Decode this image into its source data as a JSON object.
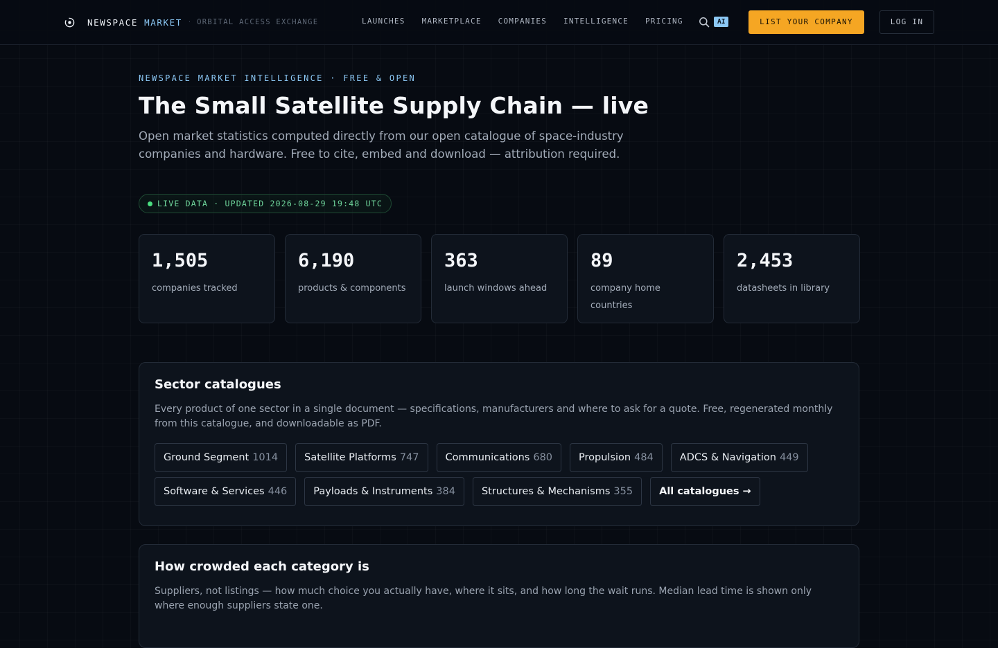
{
  "header": {
    "brand_name": "NEWSPACE",
    "brand_accent": "MARKET",
    "brand_separator": "·",
    "tagline": "ORBITAL ACCESS EXCHANGE",
    "nav": [
      "LAUNCHES",
      "MARKETPLACE",
      "COMPANIES",
      "INTELLIGENCE",
      "PRICING"
    ],
    "ai_badge": "AI",
    "cta_label": "LIST YOUR COMPANY",
    "login_label": "LOG IN"
  },
  "hero": {
    "eyebrow": "NEWSPACE MARKET INTELLIGENCE · FREE & OPEN",
    "title": "The Small Satellite Supply Chain — live",
    "lead": "Open market statistics computed directly from our open catalogue of space-industry companies and hardware. Free to cite, embed and download — attribution required.",
    "live_status": "LIVE DATA · UPDATED 2026-08-29 19:48 UTC"
  },
  "stats": [
    {
      "value": "1,505",
      "label": "companies tracked"
    },
    {
      "value": "6,190",
      "label": "products & components"
    },
    {
      "value": "363",
      "label": "launch windows ahead"
    },
    {
      "value": "89",
      "label": "company home countries"
    },
    {
      "value": "2,453",
      "label": "datasheets in library"
    }
  ],
  "sector_catalogues": {
    "title": "Sector catalogues",
    "description": "Every product of one sector in a single document — specifications, manufacturers and where to ask for a quote. Free, regenerated monthly from this catalogue, and downloadable as PDF.",
    "chips": [
      {
        "label": "Ground Segment",
        "count": "1014"
      },
      {
        "label": "Satellite Platforms",
        "count": "747"
      },
      {
        "label": "Communications",
        "count": "680"
      },
      {
        "label": "Propulsion",
        "count": "484"
      },
      {
        "label": "ADCS & Navigation",
        "count": "449"
      },
      {
        "label": "Software & Services",
        "count": "446"
      },
      {
        "label": "Payloads & Instruments",
        "count": "384"
      },
      {
        "label": "Structures & Mechanisms",
        "count": "355"
      }
    ],
    "all_label": "All catalogues →"
  },
  "crowding": {
    "title": "How crowded each category is",
    "description": "Suppliers, not listings — how much choice you actually have, where it sits, and how long the wait runs. Median lead time is shown only where enough suppliers state one."
  },
  "colors": {
    "accent_blue": "#8cc8f5",
    "cta_orange": "#f5a623",
    "live_green": "#4ade80",
    "background": "#070b12"
  },
  "icons": [
    "orbit-logo-icon",
    "search-icon"
  ]
}
